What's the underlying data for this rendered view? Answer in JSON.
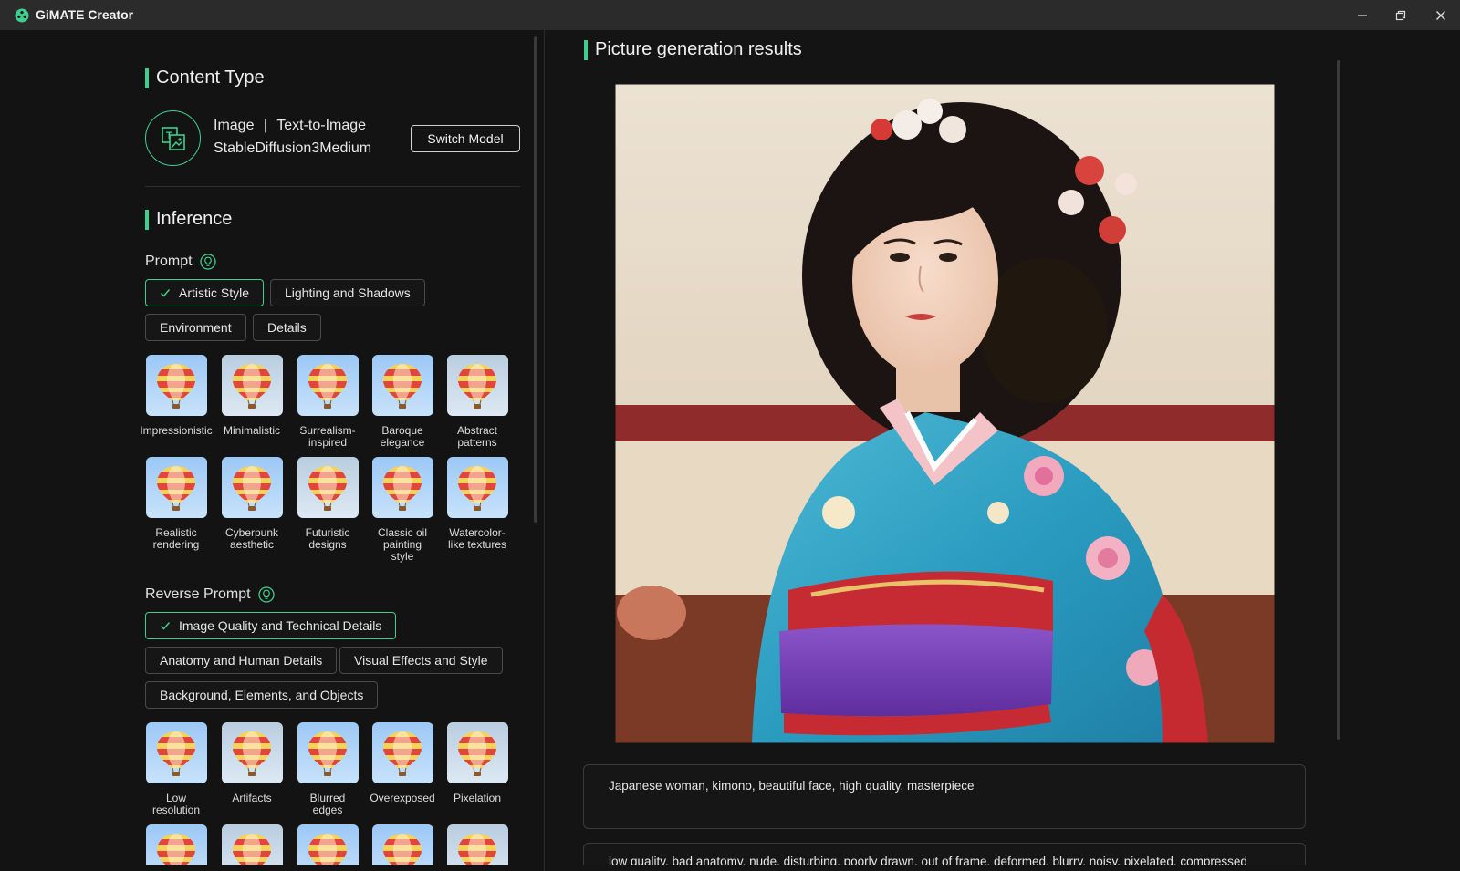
{
  "window": {
    "title": "GiMATE Creator",
    "controls": [
      "minimize-icon",
      "restore-icon",
      "close-icon"
    ]
  },
  "colors": {
    "accent": "#3ecf8e",
    "background": "#141414",
    "titlebar": "#2b2b2b"
  },
  "content_type": {
    "heading": "Content Type",
    "model_kind": "Image",
    "model_separator": "|",
    "model_task": "Text-to-Image",
    "model_name": "StableDiffusion3Medium",
    "switch_label": "Switch Model"
  },
  "inference": {
    "heading": "Inference",
    "prompt": {
      "label": "Prompt",
      "chips": [
        {
          "label": "Artistic Style",
          "selected": true
        },
        {
          "label": "Lighting and Shadows",
          "selected": false
        },
        {
          "label": "Environment",
          "selected": false
        },
        {
          "label": "Details",
          "selected": false
        }
      ],
      "styles": [
        "Impressionistic",
        "Minimalistic",
        "Surrealism-\ninspired",
        "Baroque\nelegance",
        "Abstract\npatterns",
        "Realistic\nrendering",
        "Cyberpunk\naesthetic",
        "Futuristic\ndesigns",
        "Classic oil\npainting\nstyle",
        "Watercolor-\nlike textures"
      ]
    },
    "reverse_prompt": {
      "label": "Reverse Prompt",
      "chips": [
        {
          "label": "Image Quality and Technical Details",
          "selected": true
        },
        {
          "label": "Anatomy and Human Details",
          "selected": false
        },
        {
          "label": "Visual Effects and Style",
          "selected": false
        },
        {
          "label": "Background, Elements, and Objects",
          "selected": false
        }
      ],
      "styles": [
        "Low\nresolution",
        "Artifacts",
        "Blurred\nedges",
        "Overexposed",
        "Pixelation"
      ]
    }
  },
  "results": {
    "heading": "Picture generation results",
    "prompt_text": "Japanese woman, kimono, beautiful face, high quality, masterpiece",
    "negative_prompt_text": "low quality, bad anatomy, nude, disturbing, poorly drawn, out of frame, deformed, blurry, noisy, pixelated, compressed"
  }
}
